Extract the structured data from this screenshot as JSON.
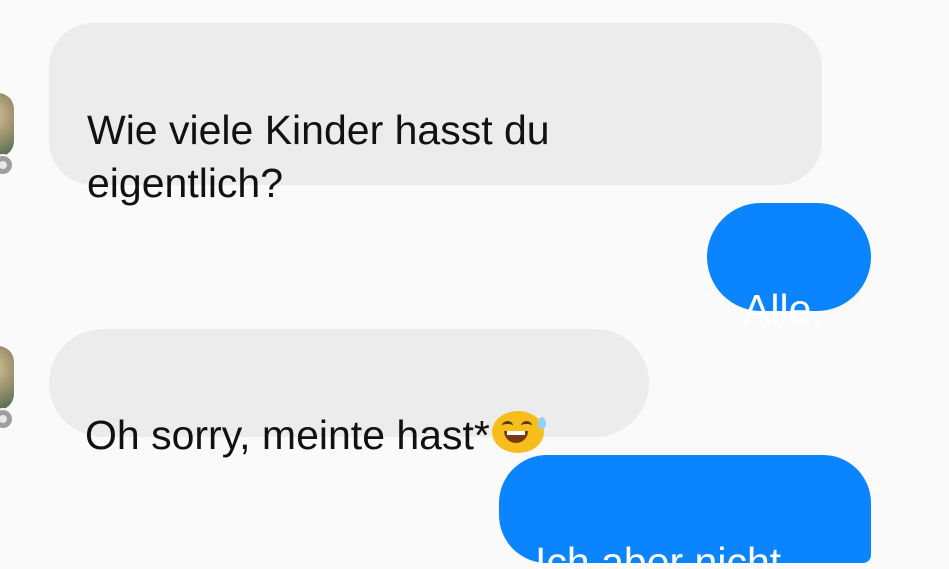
{
  "conversation": {
    "messages": [
      {
        "sender": "other",
        "text": "Wie viele Kinder hasst du\neigentlich?"
      },
      {
        "sender": "me",
        "text": "Alle."
      },
      {
        "sender": "other",
        "text": "Oh sorry, meinte hast*"
      },
      {
        "sender": "me",
        "text": "Ich aber nicht."
      }
    ]
  },
  "emoji": {
    "name": "grinning-sweat-emoji"
  },
  "colors": {
    "incoming_bubble": "#ececec",
    "outgoing_bubble": "#0a84ff",
    "background": "#fafafa"
  }
}
